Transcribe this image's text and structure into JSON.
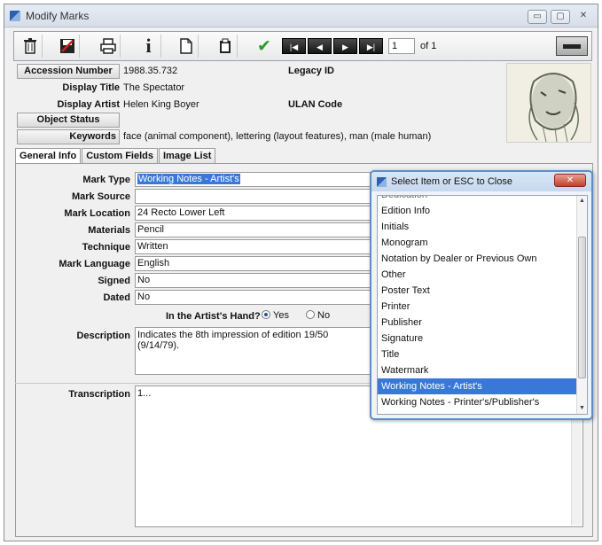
{
  "window": {
    "title": "Modify Marks",
    "minimize": "▭",
    "maximize": "▢",
    "close": "✕"
  },
  "toolbar": {
    "page_value": "1",
    "page_of": "of 1"
  },
  "record": {
    "accession_number_label": "Accession Number",
    "accession_number": "1988.35.732",
    "legacy_id_label": "Legacy ID",
    "display_title_label": "Display Title",
    "display_title": "The Spectator",
    "display_artist_label": "Display Artist",
    "display_artist": "Helen King Boyer",
    "ulan_code_label": "ULAN Code",
    "object_status_label": "Object Status",
    "keywords_label": "Keywords",
    "keywords": "face (animal component), lettering (layout features), man (male human)"
  },
  "tabs": [
    "General Info",
    "Custom Fields",
    "Image List"
  ],
  "form": {
    "mark_type_label": "Mark Type",
    "mark_type": "Working Notes - Artist's",
    "mark_source_label": "Mark Source",
    "mark_source": "",
    "mark_location_label": "Mark Location",
    "mark_location": "24 Recto Lower Left",
    "materials_label": "Materials",
    "materials": "Pencil",
    "technique_label": "Technique",
    "technique": "Written",
    "mark_language_label": "Mark Language",
    "mark_language": "English",
    "signed_label": "Signed",
    "signed": "No",
    "dated_label": "Dated",
    "dated": "No",
    "artists_hand_label": "In the Artist's Hand?",
    "yes_label": "Yes",
    "no_label": "No",
    "description_label": "Description",
    "description": "Indicates the 8th impression of edition 19/50 (9/14/79).",
    "transcription_label": "Transcription",
    "transcription": "1..."
  },
  "popup": {
    "title": "Select Item or ESC to Close",
    "close": "✕",
    "items": [
      "Dedication",
      "Edition Info",
      "Initials",
      "Monogram",
      "Notation by Dealer or Previous Own",
      "Other",
      "Poster Text",
      "Printer",
      "Publisher",
      "Signature",
      "Title",
      "Watermark",
      "Working Notes - Artist's",
      "Working Notes - Printer's/Publisher's"
    ],
    "selected_index": 12
  }
}
